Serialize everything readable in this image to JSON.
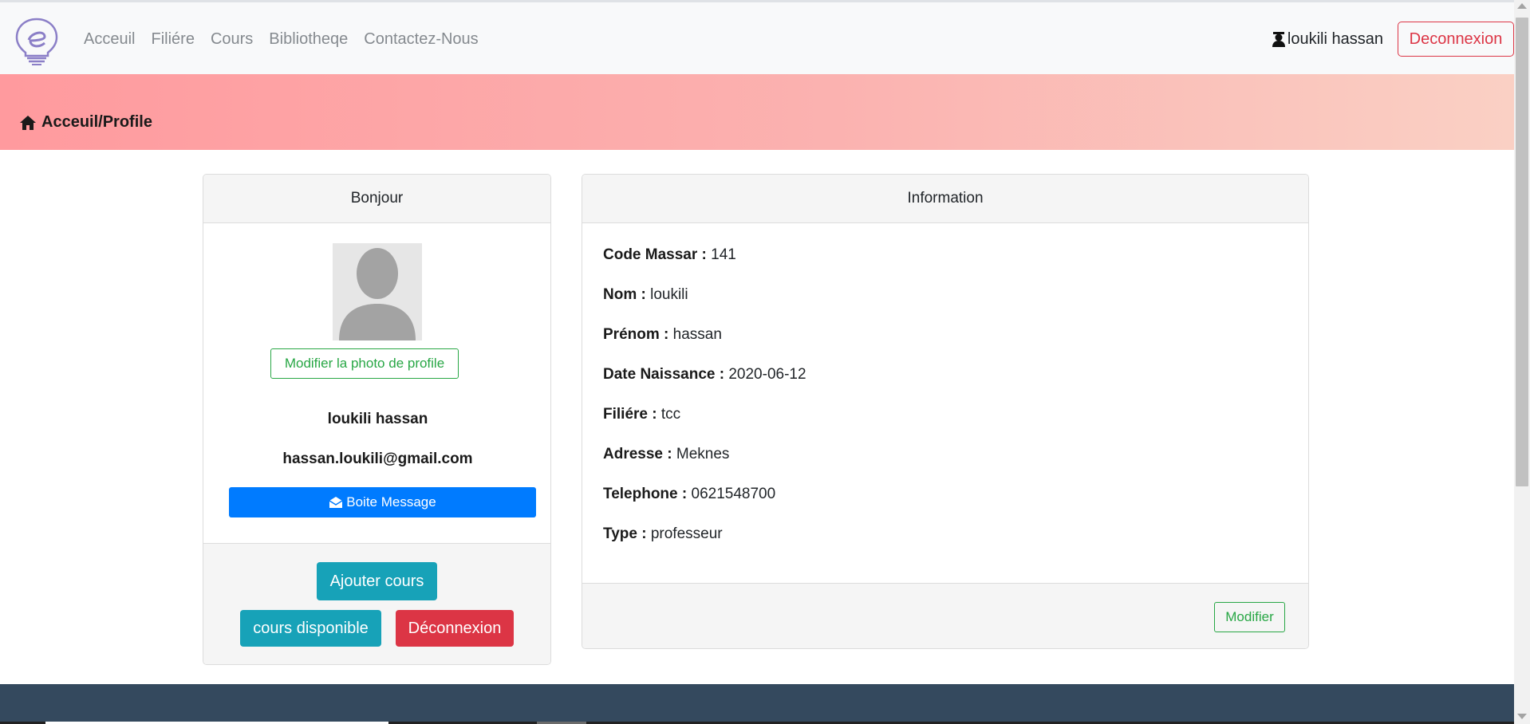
{
  "navbar": {
    "logo_icon": "lightbulb-e-logo",
    "links": [
      "Acceuil",
      "Filiére",
      "Cours",
      "Bibliotheqe",
      "Contactez-Nous"
    ],
    "user_icon": "user-graduate-icon",
    "user_name": "loukili hassan",
    "logout_label": "Deconnexion"
  },
  "banner": {
    "icon": "home-icon",
    "breadcrumb": "Acceuil/Profile"
  },
  "profile_card": {
    "header": "Bonjour",
    "avatar_icon": "default-avatar",
    "photo_button": "Modifier la photo de profile",
    "name": "loukili hassan",
    "email": "hassan.loukili@gmail.com",
    "message_icon": "envelope-open-icon",
    "message_button": "Boite Message",
    "add_course_button": "Ajouter cours",
    "available_courses_button": "cours disponible",
    "logout_button": "Déconnexion"
  },
  "info_card": {
    "header": "Information",
    "fields": [
      {
        "label": "Code Massar :",
        "value": "141"
      },
      {
        "label": "Nom :",
        "value": "loukili"
      },
      {
        "label": "Prénom :",
        "value": "hassan"
      },
      {
        "label": "Date Naissance :",
        "value": "2020-06-12"
      },
      {
        "label": "Filiére :",
        "value": "tcc"
      },
      {
        "label": "Adresse :",
        "value": "Meknes"
      },
      {
        "label": "Telephone :",
        "value": "0621548700"
      },
      {
        "label": "Type :",
        "value": "professeur"
      }
    ],
    "edit_button": "Modifier"
  },
  "colors": {
    "primary": "#007bff",
    "success": "#28a745",
    "danger": "#dc3545",
    "info": "#17a2b8",
    "footer": "#34495e",
    "banner_start": "#ff9a9e",
    "banner_end": "#fad0c4"
  }
}
